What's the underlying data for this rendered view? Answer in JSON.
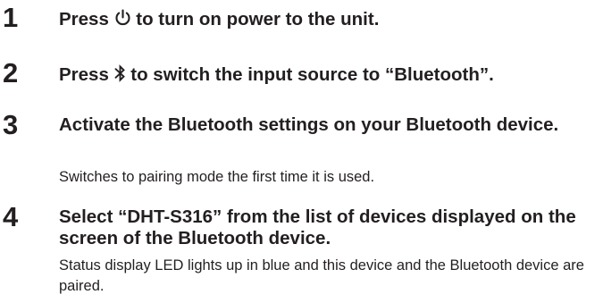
{
  "steps": [
    {
      "number": "1",
      "title_before": "Press ",
      "icon": "power-icon",
      "title_after": " to turn on power to the unit."
    },
    {
      "number": "2",
      "title_before": "Press ",
      "icon": "bluetooth-icon",
      "title_after": " to switch the input source to “Bluetooth”."
    },
    {
      "number": "3",
      "title": "Activate the Bluetooth settings on your Bluetooth device.",
      "description": "Switches to pairing mode the first time it is used."
    },
    {
      "number": "4",
      "title": "Select “DHT-S316” from the list of devices displayed on the screen of the Bluetooth device.",
      "description": "Status display LED lights up in blue and this device and the Bluetooth device are paired."
    }
  ]
}
